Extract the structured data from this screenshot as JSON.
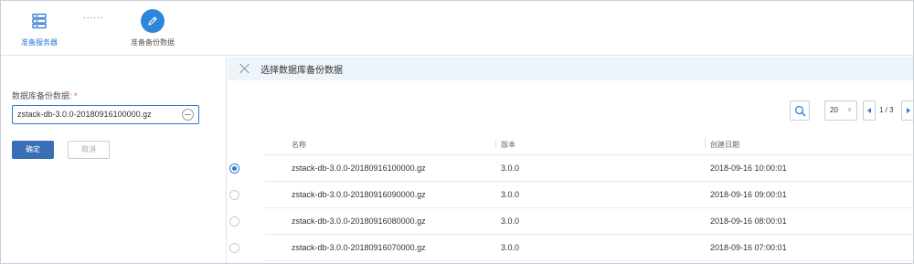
{
  "steps": [
    {
      "label": "准备服务器",
      "icon": "server-icon",
      "state": "done"
    },
    {
      "label": "准备备份数据",
      "icon": "pencil-icon",
      "state": "active"
    }
  ],
  "step_dots": "......",
  "form": {
    "field_label": "数据库备份数据:",
    "required_mark": "*",
    "value": "zstack-db-3.0.0-20180916100000.gz",
    "ok_label": "确定",
    "cancel_label": "取消"
  },
  "panel": {
    "title": "选择数据库备份数据",
    "page_size": "20",
    "page_info": "1 / 3"
  },
  "table": {
    "headers": [
      "名称",
      "版本",
      "创建日期"
    ],
    "rows": [
      {
        "selected": true,
        "name": "zstack-db-3.0.0-20180916100000.gz",
        "version": "3.0.0",
        "created": "2018-09-16 10:00:01"
      },
      {
        "selected": false,
        "name": "zstack-db-3.0.0-20180916090000.gz",
        "version": "3.0.0",
        "created": "2018-09-16 09:00:01"
      },
      {
        "selected": false,
        "name": "zstack-db-3.0.0-20180916080000.gz",
        "version": "3.0.0",
        "created": "2018-09-16 08:00:01"
      },
      {
        "selected": false,
        "name": "zstack-db-3.0.0-20180916070000.gz",
        "version": "3.0.0",
        "created": "2018-09-16 07:00:01"
      }
    ]
  },
  "colors": {
    "accent": "#2d77d2",
    "primary_button": "#3a6eb5",
    "panel_header_bg": "#edf4fa"
  }
}
